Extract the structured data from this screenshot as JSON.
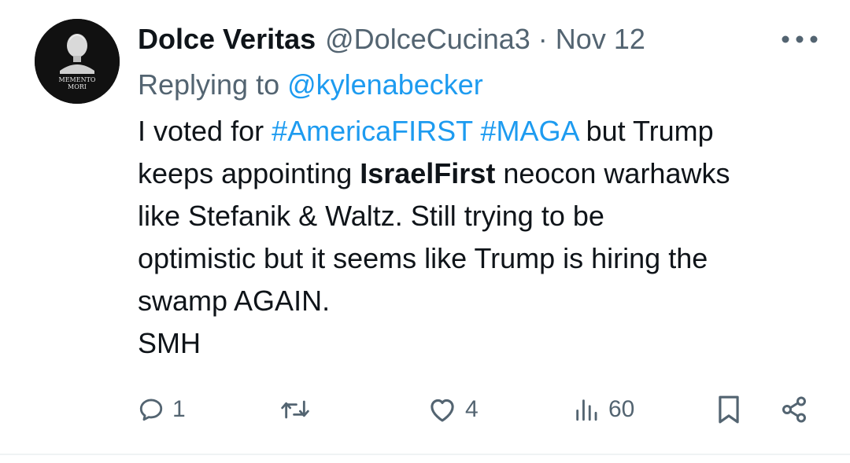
{
  "tweet": {
    "avatar": {
      "motto_line1": "MEMENTO",
      "motto_line2": "MORI"
    },
    "author": {
      "display_name": "Dolce Veritas",
      "handle": "@DolceCucina3",
      "separator": "·",
      "date": "Nov 12"
    },
    "more_icon": "more-horizontal-icon",
    "reply": {
      "label": "Replying to ",
      "handle": "@kylenabecker"
    },
    "text": {
      "l1_pre": "I voted for ",
      "l1_tag1": "#AmericaFIRST",
      "l1_space": " ",
      "l1_tag2": "#MAGA",
      "l1_post": " but Trump",
      "l2_pre": "keeps appointing ",
      "l2_bold": "IsraelFirst",
      "l2_post": " neocon warhawks",
      "l3": "like Stefanik & Waltz.  Still trying to be",
      "l4": "optimistic but it seems like Trump is hiring the",
      "l5": "swamp AGAIN.",
      "l6": "SMH"
    },
    "actions": {
      "reply_count": "1",
      "like_count": "4",
      "views_count": "60"
    },
    "colors": {
      "accent": "#1d9bf0",
      "muted": "#536471",
      "text": "#0f1419"
    }
  }
}
